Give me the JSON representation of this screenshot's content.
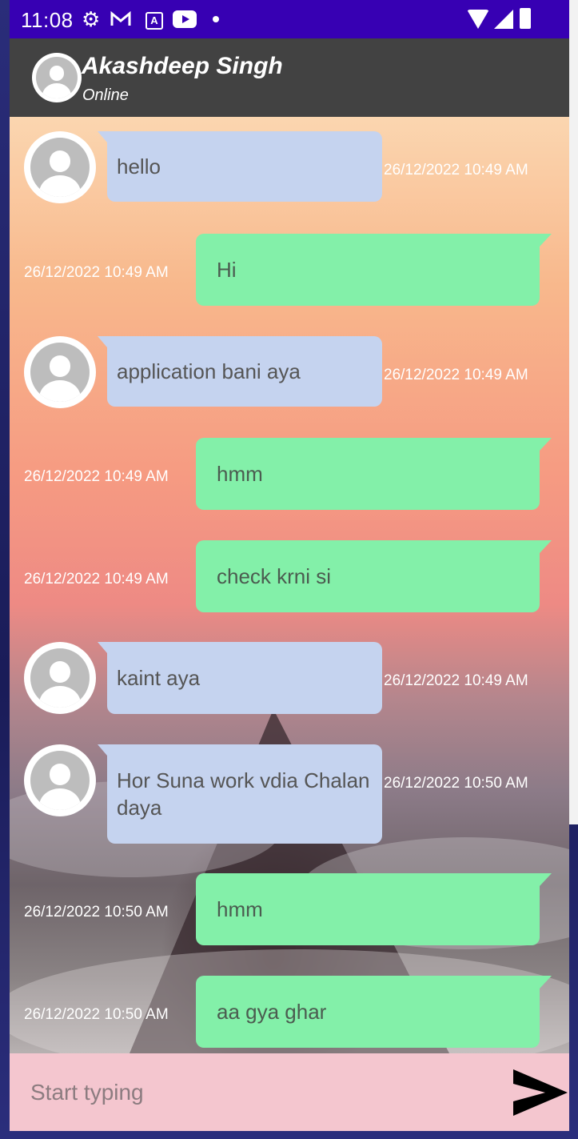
{
  "status_bar": {
    "time": "11:08"
  },
  "toolbar": {
    "name": "Akashdeep Singh",
    "status": "Online"
  },
  "messages": [
    {
      "type": "received",
      "text": "hello",
      "time": "26/12/2022 10:49 AM"
    },
    {
      "type": "sent",
      "text": "Hi",
      "time": "26/12/2022 10:49 AM"
    },
    {
      "type": "received",
      "text": "application bani aya",
      "time": "26/12/2022 10:49 AM"
    },
    {
      "type": "sent",
      "text": "hmm",
      "time": "26/12/2022 10:49 AM"
    },
    {
      "type": "sent",
      "text": "check krni si",
      "time": "26/12/2022 10:49 AM"
    },
    {
      "type": "received",
      "text": "kaint aya",
      "time": "26/12/2022 10:49 AM"
    },
    {
      "type": "received",
      "text": "Hor Suna work vdia Chalan daya",
      "time": "26/12/2022 10:50 AM"
    },
    {
      "type": "sent",
      "text": "hmm",
      "time": "26/12/2022 10:50 AM"
    },
    {
      "type": "sent",
      "text": "aa gya ghar",
      "time": "26/12/2022 10:50 AM"
    }
  ],
  "input": {
    "placeholder": "Start typing",
    "value": ""
  },
  "colors": {
    "status_bar": "#3700b3",
    "toolbar": "#424242",
    "received_bubble": "#c5d3ef",
    "sent_bubble": "#83f0a9",
    "input_bar": "#f4c6cf"
  },
  "icons": {
    "send": "send-arrow-icon",
    "settings": "gear-icon",
    "mail": "gmail-icon",
    "youtube": "youtube-icon",
    "wifi": "wifi-icon",
    "signal": "signal-icon",
    "battery": "battery-icon"
  }
}
